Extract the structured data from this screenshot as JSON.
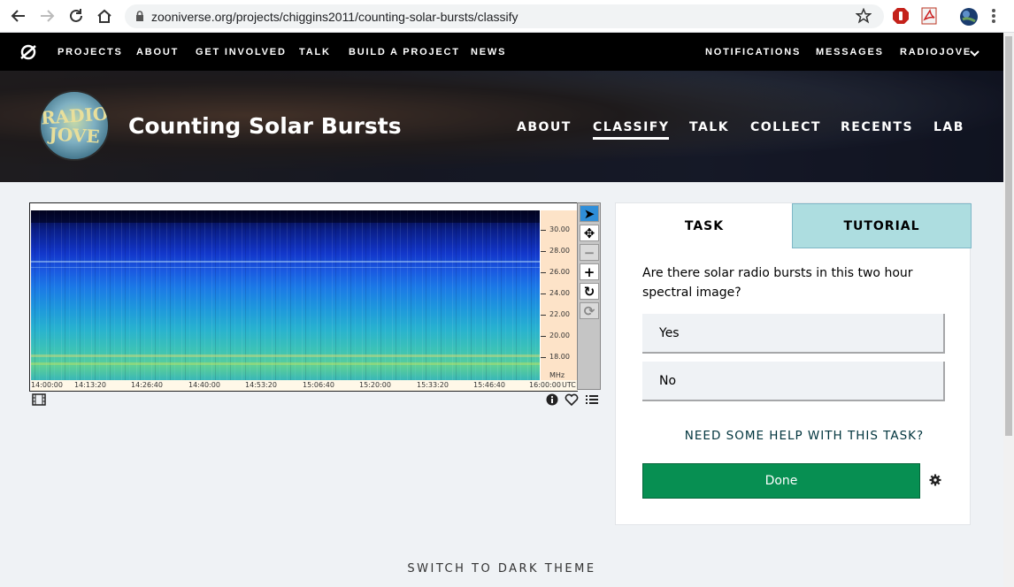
{
  "browser": {
    "url": "zooniverse.org/projects/chiggins2011/counting-solar-bursts/classify"
  },
  "site_nav": {
    "items": [
      "PROJECTS",
      "ABOUT",
      "GET INVOLVED",
      "TALK",
      "BUILD A PROJECT",
      "NEWS"
    ],
    "right": [
      "NOTIFICATIONS",
      "MESSAGES",
      "RADIOJOVE"
    ]
  },
  "project": {
    "avatar_text_1": "RADIO",
    "avatar_text_2": "JOVE",
    "title": "Counting Solar Bursts",
    "tabs": [
      "ABOUT",
      "CLASSIFY",
      "TALK",
      "COLLECT",
      "RECENTS",
      "LAB"
    ],
    "active_tab": "CLASSIFY"
  },
  "viewer": {
    "freq_labels": [
      "30.00",
      "28.00",
      "26.00",
      "24.00",
      "22.00",
      "20.00",
      "18.00"
    ],
    "freq_unit": "MHz",
    "time_labels": [
      "14:00:00",
      "14:13:20",
      "14:26:40",
      "14:40:00",
      "14:53:20",
      "15:06:40",
      "15:20:00",
      "15:33:20",
      "15:46:40",
      "16:00:00"
    ],
    "time_unit": "UTC",
    "tools": [
      {
        "icon": "pointer-icon",
        "glyph": "➤",
        "state": "active"
      },
      {
        "icon": "move-icon",
        "glyph": "✥",
        "state": "normal"
      },
      {
        "icon": "zoom-out-icon",
        "glyph": "−",
        "state": "disabled"
      },
      {
        "icon": "zoom-in-icon",
        "glyph": "+",
        "state": "normal"
      },
      {
        "icon": "rotate-icon",
        "glyph": "↻",
        "state": "normal"
      },
      {
        "icon": "reset-icon",
        "glyph": "⟳",
        "state": "disabled"
      }
    ]
  },
  "task": {
    "tab_task": "TASK",
    "tab_tutorial": "TUTORIAL",
    "question": "Are there solar radio bursts in this two hour spectral image?",
    "answers": [
      "Yes",
      "No"
    ],
    "help_link": "NEED SOME HELP WITH THIS TASK?",
    "done_label": "Done"
  },
  "footer": {
    "dark_theme": "SWITCH TO DARK THEME"
  },
  "colors": {
    "nav_bg": "#000000",
    "done_green": "#078f52",
    "tutorial_tab": "#addde0",
    "page_bg": "#eff2f5"
  }
}
